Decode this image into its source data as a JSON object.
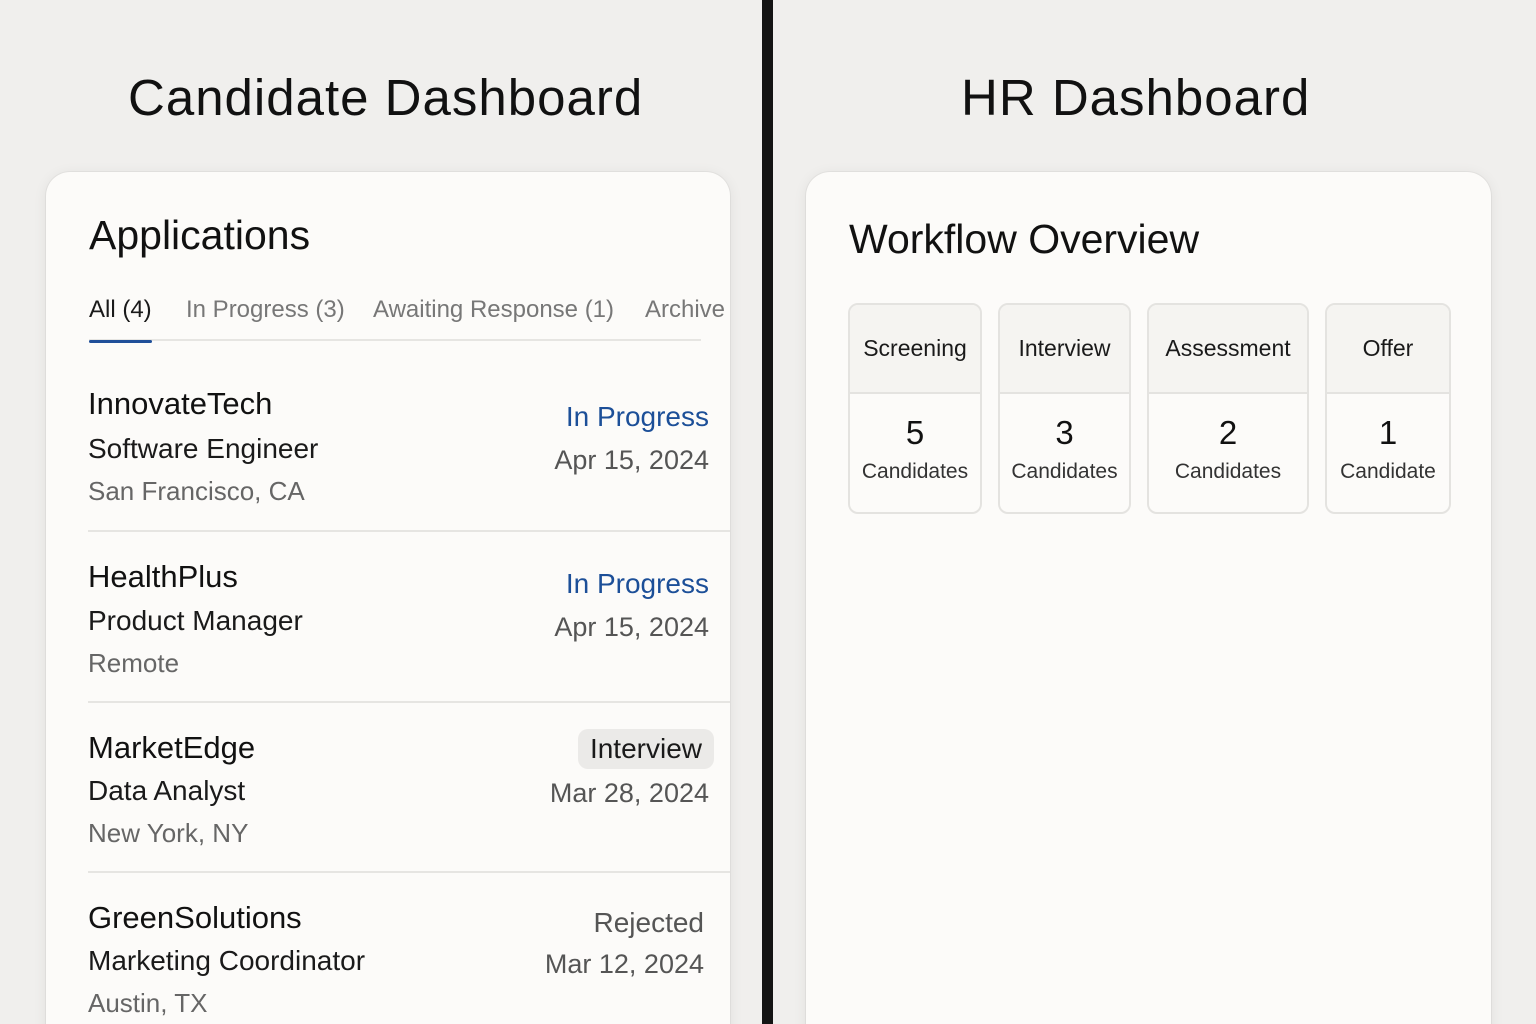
{
  "candidate_dashboard": {
    "title": "Candidate Dashboard",
    "heading": "Applications",
    "tabs": [
      {
        "label": "All (4)"
      },
      {
        "label": "In Progress (3)"
      },
      {
        "label": "Awaiting Response (1)"
      },
      {
        "label": "Archive"
      }
    ],
    "applications": [
      {
        "company": "InnovateTech",
        "role": "Software Engineer",
        "location": "San Francisco, CA",
        "status": "In Progress",
        "date": "Apr 15, 2024"
      },
      {
        "company": "HealthPlus",
        "role": "Product Manager",
        "location": "Remote",
        "status": "In Progress",
        "date": "Apr 15, 2024"
      },
      {
        "company": "MarketEdge",
        "role": "Data Analyst",
        "location": "New York, NY",
        "status": "Interview",
        "date": "Mar 28, 2024"
      },
      {
        "company": "GreenSolutions",
        "role": "Marketing Coordinator",
        "location": "Austin, TX",
        "status": "Rejected",
        "date": "Mar 12, 2024"
      }
    ]
  },
  "hr_dashboard": {
    "title": "HR Dashboard",
    "heading": "Workflow Overview",
    "stages": [
      {
        "name": "Screening",
        "count": "5",
        "unit": "Candidates"
      },
      {
        "name": "Interview",
        "count": "3",
        "unit": "Candidates"
      },
      {
        "name": "Assessment",
        "count": "2",
        "unit": "Candidates"
      },
      {
        "name": "Offer",
        "count": "1",
        "unit": "Candidate"
      }
    ]
  },
  "colors": {
    "accent": "#1f4f99",
    "status_in_progress": "#1c4f98",
    "divider": "#141414",
    "background": "#f0efed",
    "card": "#fcfbf9"
  }
}
